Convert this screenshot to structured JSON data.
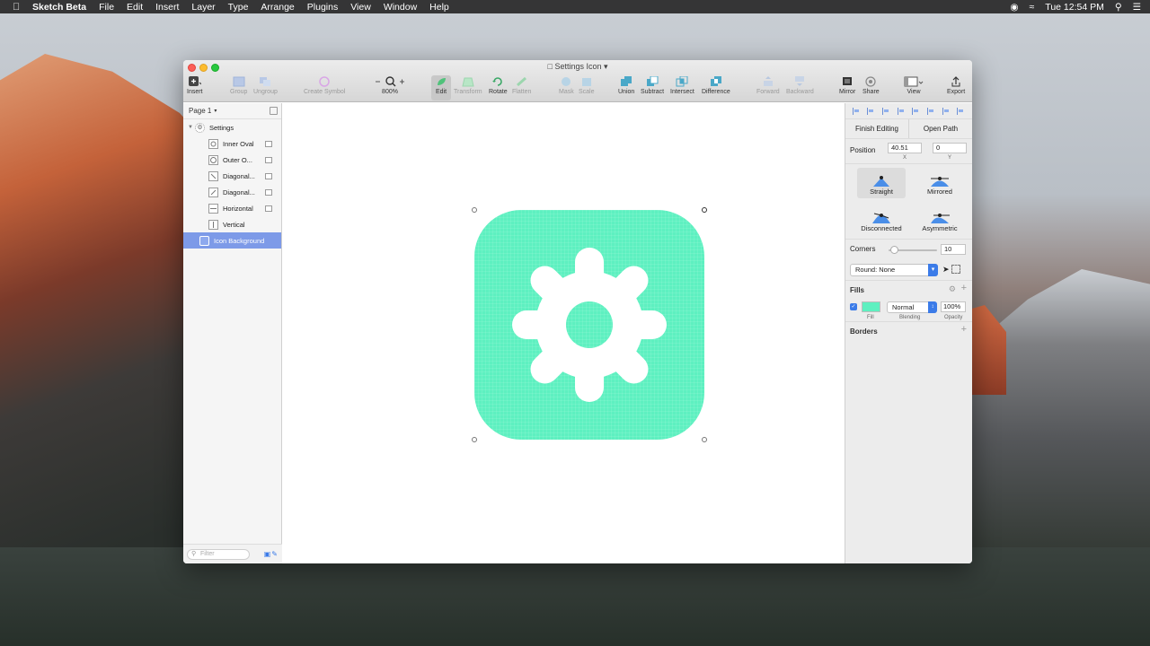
{
  "menubar": {
    "app_name": "Sketch Beta",
    "items": [
      "File",
      "Edit",
      "Insert",
      "Layer",
      "Type",
      "Arrange",
      "Plugins",
      "View",
      "Window",
      "Help"
    ],
    "clock": "Tue 12:54 PM"
  },
  "window": {
    "title": "Settings Icon"
  },
  "toolbar": {
    "insert": "Insert",
    "group": "Group",
    "ungroup": "Ungroup",
    "create_symbol": "Create Symbol",
    "zoom": "800%",
    "edit": "Edit",
    "transform": "Transform",
    "rotate": "Rotate",
    "flatten": "Flatten",
    "mask": "Mask",
    "scale": "Scale",
    "union": "Union",
    "subtract": "Subtract",
    "intersect": "Intersect",
    "difference": "Difference",
    "forward": "Forward",
    "backward": "Backward",
    "mirror": "Mirror",
    "share": "Share",
    "view": "View",
    "export": "Export"
  },
  "layers": {
    "page": "Page 1",
    "group": "Settings",
    "items": [
      {
        "label": "Inner Oval",
        "icon": "oval-icon"
      },
      {
        "label": "Outer O...",
        "icon": "oval-icon"
      },
      {
        "label": "Diagonal...",
        "icon": "rect-icon"
      },
      {
        "label": "Diagonal...",
        "icon": "rect-icon"
      },
      {
        "label": "Horizontal",
        "icon": "rect-icon"
      },
      {
        "label": "Vertical",
        "icon": "rect-icon"
      }
    ],
    "selected": "Icon Background",
    "filter_placeholder": "Filter"
  },
  "artwork": {
    "bg_color": "#5ef0c0",
    "gear_color": "#ffffff"
  },
  "inspector": {
    "finish_editing": "Finish Editing",
    "open_path": "Open Path",
    "position_label": "Position",
    "x_value": "40.51",
    "y_value": "0",
    "x_sub": "X",
    "y_sub": "Y",
    "points": {
      "straight": "Straight",
      "mirrored": "Mirrored",
      "disconnected": "Disconnected",
      "asymmetric": "Asymmetric"
    },
    "corners_label": "Corners",
    "corners_value": "10",
    "round_value": "Round: None",
    "fills_title": "Fills",
    "fill_blend": "Normal",
    "fill_opacity": "100%",
    "fill_sub": "Fill",
    "blending_sub": "Blending",
    "opacity_sub": "Opacity",
    "borders_title": "Borders"
  },
  "colors": {
    "accent": "#3b7be8",
    "selection": "#7d9ae8",
    "mint": "#5ef0c0"
  }
}
